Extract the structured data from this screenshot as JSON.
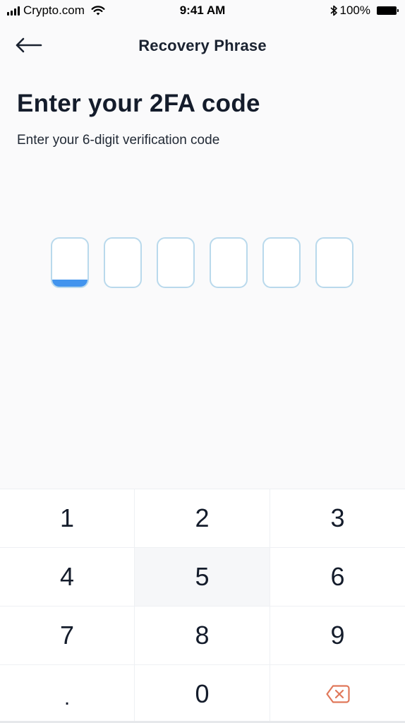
{
  "status_bar": {
    "carrier": "Crypto.com",
    "time": "9:41 AM",
    "battery": "100%",
    "icons": [
      "signal-icon",
      "wifi-icon",
      "bluetooth-icon",
      "battery-icon"
    ]
  },
  "header": {
    "back_icon": "arrow-left-icon",
    "title": "Recovery Phrase"
  },
  "main": {
    "title": "Enter your 2FA code",
    "subtitle": "Enter your 6-digit verification code",
    "code_inputs": [
      {
        "value": "",
        "active": true
      },
      {
        "value": "",
        "active": false
      },
      {
        "value": "",
        "active": false
      },
      {
        "value": "",
        "active": false
      },
      {
        "value": "",
        "active": false
      },
      {
        "value": "",
        "active": false
      }
    ]
  },
  "keypad": {
    "keys": [
      "1",
      "2",
      "3",
      "4",
      "5",
      "6",
      "7",
      "8",
      "9",
      ".",
      "0"
    ],
    "backspace_icon": "backspace-icon"
  },
  "colors": {
    "accent": "#4294ee",
    "input_border": "#b9d9ec",
    "backspace": "#e0785a",
    "text": "#141c2b"
  }
}
